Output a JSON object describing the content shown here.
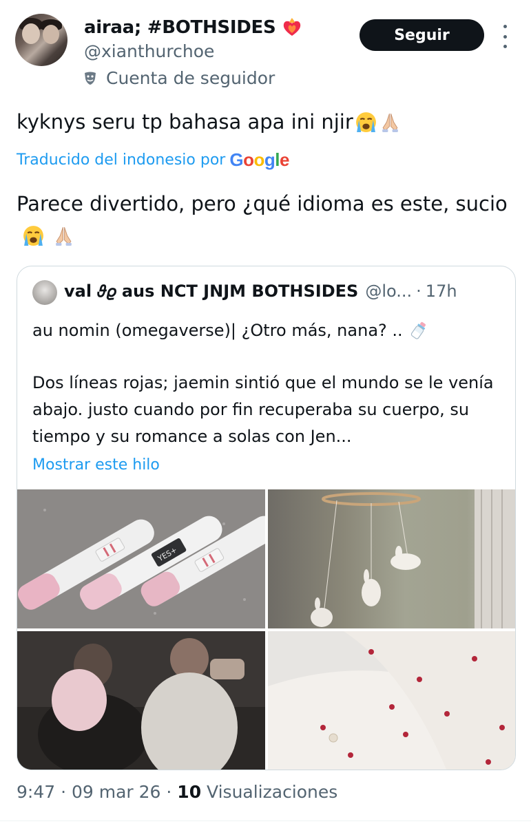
{
  "author": {
    "display_name": "airaa; #BOTHSIDES",
    "handle": "@xianthurchoe",
    "account_label": "Cuenta de seguidor",
    "follow_label": "Seguir"
  },
  "tweet": {
    "text": "kyknys seru tp bahasa apa ini njir",
    "translated_label": "Traducido del indonesio por",
    "translated_provider": "Google",
    "translation": "Parece divertido, pero ¿qué idioma es este, sucio"
  },
  "quote": {
    "name": "val 𝜗𝜚 aus NCT JNJM BOTHSIDES",
    "handle": "@lo...",
    "separator": "·",
    "time": "17h",
    "title": "au nomin (omegaverse)| ¿Otro más, nana? ..",
    "body": "Dos líneas rojas; jaemin sintió que el mundo se le venía abajo. justo cuando por fin recuperaba su cuerpo, su tiempo y su romance a solas con Jen...",
    "show_thread": "Mostrar este hilo",
    "test_screen_text": "YES+"
  },
  "footer": {
    "time": "9:47",
    "sep1": " · ",
    "date": "09 mar 26",
    "sep2": " · ",
    "views_count": "10",
    "views_label": " Visualizaciones"
  },
  "colors": {
    "link": "#1d9bf0",
    "secondary_text": "#536471",
    "primary_text": "#0f1419",
    "button_bg": "#0f1419",
    "border": "#cfd9de"
  },
  "icons": [
    "heart-on-fire-icon",
    "theater-masks-icon",
    "more-icon",
    "loudly-crying-face-icon",
    "folded-hands-icon",
    "baby-bottle-icon"
  ]
}
